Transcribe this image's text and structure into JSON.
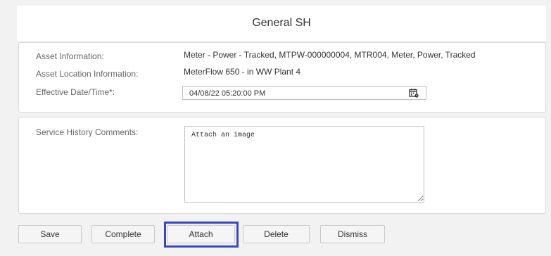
{
  "form": {
    "title": "General SH"
  },
  "info": {
    "asset_label": "Asset Information:",
    "asset_value": "Meter - Power - Tracked, MTPW-000000004, MTR004, Meter, Power, Tracked",
    "location_label": "Asset Location Information:",
    "location_value": "MeterFlow 650 - in WW Plant 4",
    "date_label": "Effective Date/Time*:",
    "date_value": "04/08/22 05:20:00 PM",
    "date_icon": "calendar-icon"
  },
  "comments": {
    "label": "Service History Comments:",
    "value": "Attach an image"
  },
  "buttons": {
    "save": "Save",
    "complete": "Complete",
    "attach": "Attach",
    "delete": "Delete",
    "dismiss": "Dismiss"
  },
  "colors": {
    "highlight": "#3a47c4",
    "background": "#f2f2f2",
    "panel": "#ffffff"
  }
}
